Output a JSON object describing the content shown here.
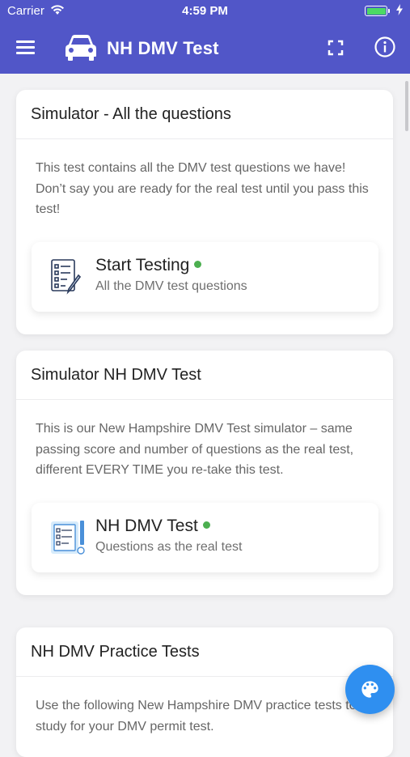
{
  "status_bar": {
    "carrier": "Carrier",
    "time": "4:59 PM",
    "icons": [
      "wifi-icon",
      "battery-icon",
      "charging-icon"
    ]
  },
  "toolbar": {
    "title": "NH DMV Test",
    "icons": [
      "menu-icon",
      "car-icon",
      "fullscreen-icon",
      "info-icon"
    ],
    "color": "#5156c8"
  },
  "cards": [
    {
      "title": "Simulator - All the questions",
      "description": "This test contains all the DMV test questions we have! Don’t say you are ready for the real test until you pass this test!",
      "item": {
        "title": "Start Testing",
        "subtitle": "All the DMV test questions",
        "icon": "checklist-icon"
      }
    },
    {
      "title": "Simulator NH DMV Test",
      "description": "This is our New Hampshire DMV Test simulator – same passing score and number of questions as the real test, different EVERY TIME you re-take this test.",
      "item": {
        "title": "NH DMV Test",
        "subtitle": "Questions as the real test",
        "icon": "test-sheet-icon"
      }
    },
    {
      "title": "NH DMV Practice Tests",
      "description": "Use the following New Hampshire DMV practice tests to study for your DMV permit test."
    }
  ],
  "fab": {
    "icon": "palette-icon",
    "color": "#2f8ff0"
  },
  "accent": {
    "online_dot": "#4caf50"
  }
}
